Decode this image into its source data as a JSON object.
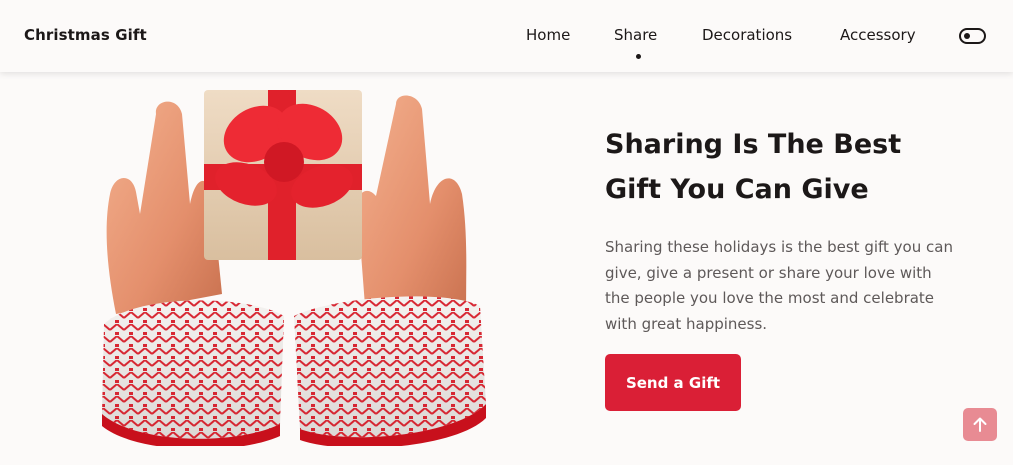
{
  "header": {
    "logo": "Christmas Gift",
    "nav": [
      {
        "label": "Home",
        "active": false
      },
      {
        "label": "Share",
        "active": true
      },
      {
        "label": "Decorations",
        "active": false
      },
      {
        "label": "Accessory",
        "active": false
      }
    ],
    "theme_toggle_icon": "toggle-icon"
  },
  "hero": {
    "image_icon": "hands-holding-gift-illustration",
    "title": "Sharing Is The Best Gift You Can Give",
    "description": "Sharing these holidays is the best gift you can give, give a present or share your love with the people you love the most and celebrate with great happiness.",
    "cta_label": "Send a Gift"
  },
  "scroll_up_icon": "arrow-up-icon",
  "colors": {
    "accent": "#da1f36",
    "background": "#fcfaf9",
    "text": "#1c1818",
    "muted_text": "#5e5959",
    "scroll_button": "#e88b93"
  }
}
